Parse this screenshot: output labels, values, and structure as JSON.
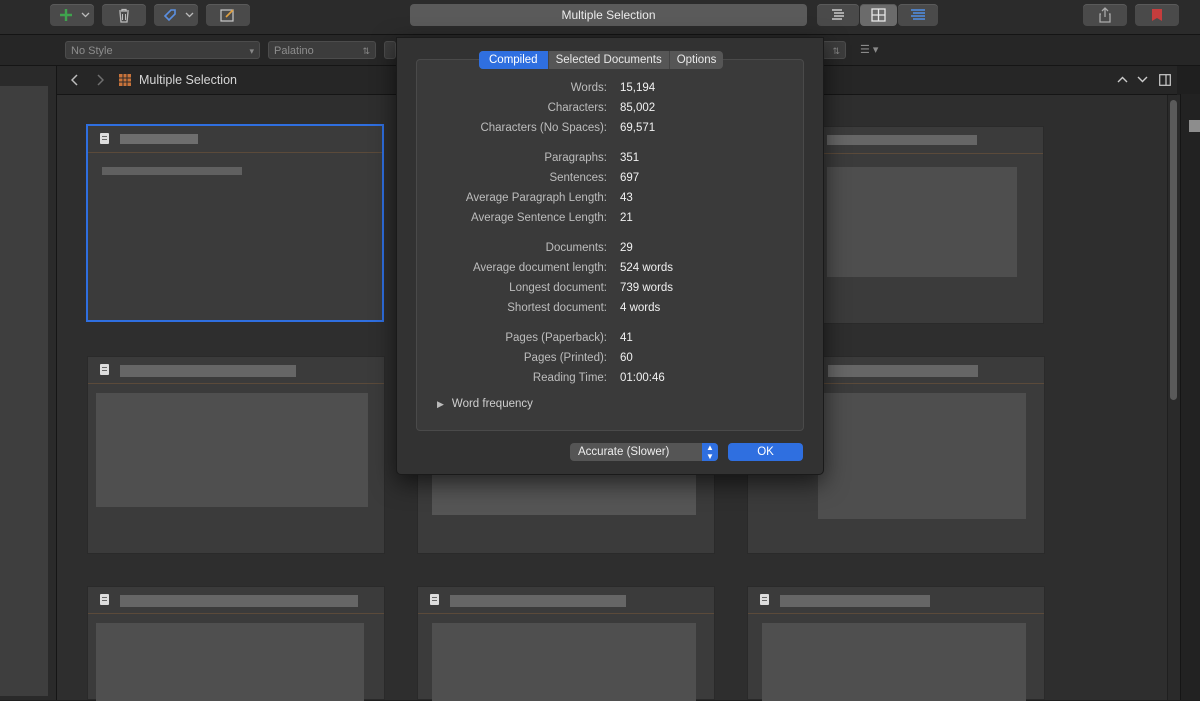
{
  "window": {
    "title": "Multiple Selection"
  },
  "formatbar": {
    "style": "No Style",
    "font": "Palatino"
  },
  "navbar": {
    "title": "Multiple Selection"
  },
  "dialog": {
    "tabs": [
      {
        "label": "Compiled",
        "active": true
      },
      {
        "label": "Selected Documents",
        "active": false
      },
      {
        "label": "Options",
        "active": false
      }
    ],
    "stats": [
      {
        "label": "Words:",
        "value": "15,194"
      },
      {
        "label": "Characters:",
        "value": "85,002"
      },
      {
        "label": "Characters (No Spaces):",
        "value": "69,571"
      },
      {
        "label": "Paragraphs:",
        "value": "351"
      },
      {
        "label": "Sentences:",
        "value": "697"
      },
      {
        "label": "Average Paragraph Length:",
        "value": "43"
      },
      {
        "label": "Average Sentence Length:",
        "value": "21"
      },
      {
        "label": "Documents:",
        "value": "29"
      },
      {
        "label": "Average document length:",
        "value": "524 words"
      },
      {
        "label": "Longest document:",
        "value": "739 words"
      },
      {
        "label": "Shortest document:",
        "value": "4 words"
      },
      {
        "label": "Pages (Paperback):",
        "value": "41"
      },
      {
        "label": "Pages (Printed):",
        "value": "60"
      },
      {
        "label": "Reading Time:",
        "value": "01:00:46"
      }
    ],
    "word_frequency_label": "Word frequency",
    "accuracy_option": "Accurate (Slower)",
    "ok_label": "OK"
  },
  "colors": {
    "accent": "#2f6fe0",
    "card_bg": "#3b3b3b",
    "dialog_bg": "#323232"
  }
}
